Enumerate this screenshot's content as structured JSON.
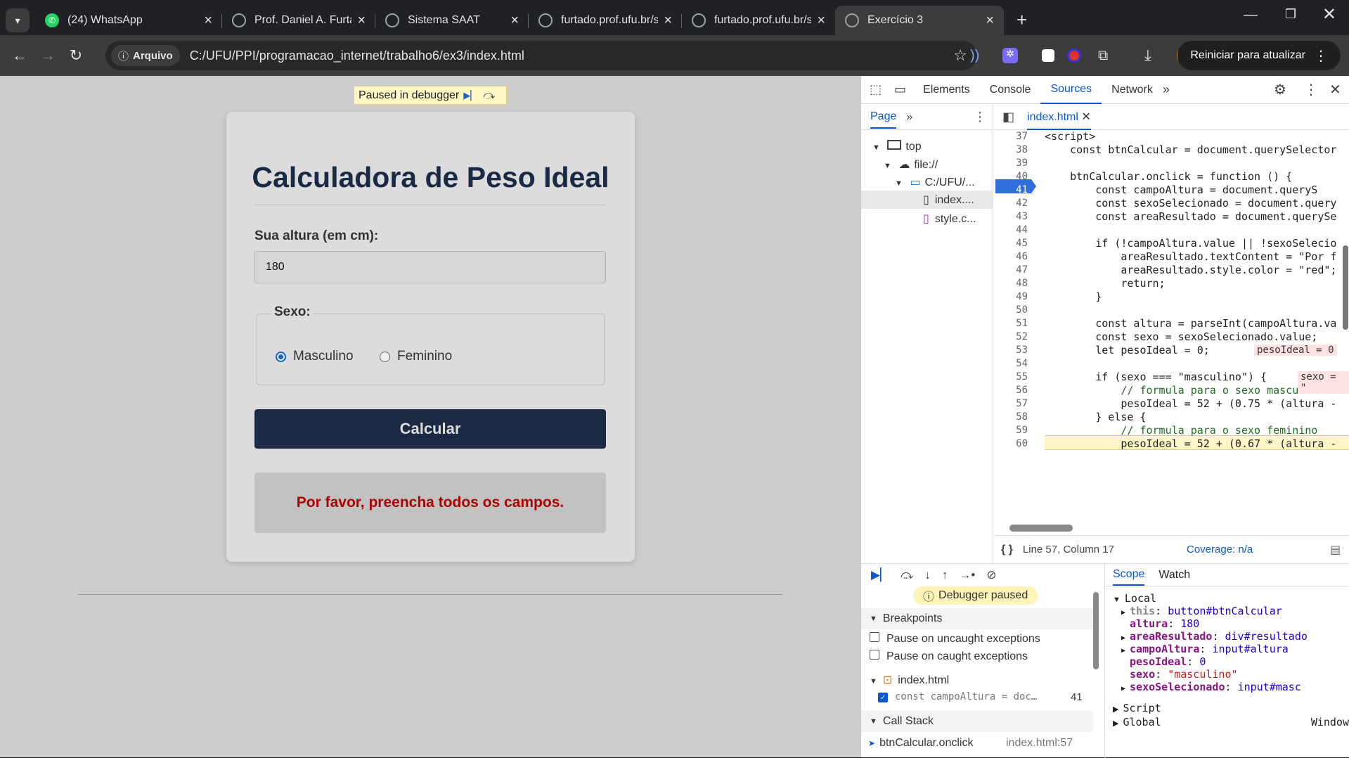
{
  "browser": {
    "tabs": [
      {
        "title": "(24) WhatsApp",
        "icon": "whatsapp-icon"
      },
      {
        "title": "Prof. Daniel A. Furtado",
        "icon": "globe-icon"
      },
      {
        "title": "Sistema SAAT",
        "icon": "globe-icon"
      },
      {
        "title": "furtado.prof.ufu.br/site/tea",
        "icon": "globe-icon"
      },
      {
        "title": "furtado.prof.ufu.br/site/tea",
        "icon": "globe-icon"
      },
      {
        "title": "Exercício 3",
        "icon": "globe-icon",
        "active": true
      }
    ],
    "chip_label": "Arquivo",
    "url": "C:/UFU/PPI/programacao_internet/trabalho6/ex3/index.html",
    "restart_label": "Reiniciar para atualizar"
  },
  "page": {
    "paused_label": "Paused in debugger",
    "title": "Calculadora de Peso Ideal",
    "height_label": "Sua altura (em cm):",
    "height_value": "180",
    "sex_legend": "Sexo:",
    "radio_male": "Masculino",
    "radio_female": "Feminino",
    "button_label": "Calcular",
    "result_text": "Por favor, preencha todos os campos."
  },
  "devtools": {
    "tabs": [
      "Elements",
      "Console",
      "Sources",
      "Network"
    ],
    "nav_tab": "Page",
    "tree": [
      "top",
      "file://",
      "C:/UFU/...",
      "index....",
      "style.c..."
    ],
    "file_tab": "index.html",
    "code_lines": [
      {
        "n": "37",
        "t": "<script>"
      },
      {
        "n": "38",
        "t": "    const btnCalcular = document.querySelector"
      },
      {
        "n": "39",
        "t": ""
      },
      {
        "n": "40",
        "t": "    btnCalcular.onclick = function () {"
      },
      {
        "n": "41",
        "t": "        const campoAltura = document.queryS"
      },
      {
        "n": "42",
        "t": "        const sexoSelecionado = document.query"
      },
      {
        "n": "43",
        "t": "        const areaResultado = document.querySe"
      },
      {
        "n": "44",
        "t": ""
      },
      {
        "n": "45",
        "t": "        if (!campoAltura.value || !sexoSelecio"
      },
      {
        "n": "46",
        "t": "            areaResultado.textContent = \"Por f"
      },
      {
        "n": "47",
        "t": "            areaResultado.style.color = \"red\";"
      },
      {
        "n": "48",
        "t": "            return;"
      },
      {
        "n": "49",
        "t": "        }"
      },
      {
        "n": "50",
        "t": ""
      },
      {
        "n": "51",
        "t": "        const altura = parseInt(campoAltura.va"
      },
      {
        "n": "52",
        "t": "        const sexo = sexoSelecionado.value;"
      },
      {
        "n": "53",
        "t": "        let pesoIdeal = 0;"
      },
      {
        "n": "54",
        "t": ""
      },
      {
        "n": "55",
        "t": "        if (sexo === \"masculino\") {"
      },
      {
        "n": "56",
        "t": "            // formula para o sexo masculino"
      },
      {
        "n": "57",
        "t": "            pesoIdeal = 52 + (0.75 * (altura -"
      },
      {
        "n": "58",
        "t": "        } else {"
      },
      {
        "n": "59",
        "t": "            // formula para o sexo feminino"
      },
      {
        "n": "60",
        "t": "            pesoIdeal = 52 + (0.67 * (altura -"
      }
    ],
    "inline_53": "pesoIdeal = 0",
    "inline_55": "sexo = \"",
    "status_position": "Line 57, Column 17",
    "coverage": "Coverage: n/a",
    "debugger_paused": "Debugger paused",
    "breakpoints_title": "Breakpoints",
    "pause_uncaught": "Pause on uncaught exceptions",
    "pause_caught": "Pause on caught exceptions",
    "bp_file": "index.html",
    "bp_code": "const campoAltura = doc…",
    "bp_line": "41",
    "callstack_title": "Call Stack",
    "callstack_fn": "btnCalcular.onclick",
    "callstack_loc": "index.html:57",
    "scope_tab": "Scope",
    "watch_tab": "Watch",
    "local_title": "Local",
    "scope": [
      {
        "k": "this",
        "v": "button#btnCalcular"
      },
      {
        "k": "altura",
        "v": "180"
      },
      {
        "k": "areaResultado",
        "v": "div#resultado"
      },
      {
        "k": "campoAltura",
        "v": "input#altura"
      },
      {
        "k": "pesoIdeal",
        "v": "0"
      },
      {
        "k": "sexo",
        "v": "\"masculino\""
      },
      {
        "k": "sexoSelecionado",
        "v": "input#masc"
      }
    ],
    "script_title": "Script",
    "global_title": "Global",
    "global_value": "Window"
  },
  "colors": {
    "accent": "#0b57d0",
    "button": "#1b2a44",
    "error": "#b00000",
    "exec_line": "#fff6c7"
  }
}
